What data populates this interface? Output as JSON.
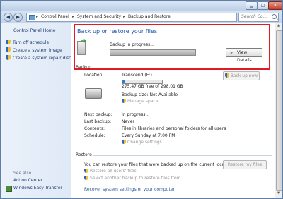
{
  "window": {
    "minimize_glyph": "▁",
    "maximize_glyph": "□",
    "close_glyph": "✕"
  },
  "nav": {
    "back_glyph": "◀",
    "forward_glyph": "▶",
    "breadcrumbs": [
      "Control Panel",
      "System and Security",
      "Backup and Restore"
    ],
    "separator": "▸",
    "refresh_glyph": "↻",
    "search_placeholder": "Search Co..."
  },
  "sidebar": {
    "home": "Control Panel Home",
    "links": [
      {
        "label": "Turn off schedule",
        "icon": "shield-icon"
      },
      {
        "label": "Create a system image",
        "icon": "shield-icon"
      },
      {
        "label": "Create a system repair disc",
        "icon": "shield-icon"
      }
    ],
    "see_also": "See also",
    "see_also_items": [
      "Action Center",
      "Windows Easy Transfer"
    ]
  },
  "main": {
    "title": "Back up or restore your files",
    "in_progress": {
      "status": "Backup in progress...",
      "progress_fraction": 0.0,
      "view_details": "View Details"
    },
    "backup_section": "Backup",
    "location_label": "Location:",
    "location_value": "Transcend (E:)",
    "drive_used_fraction": 0.08,
    "free_space": "275.47 GB free of 298.01 GB",
    "backup_size": "Backup size: Not Available",
    "manage_space": "Manage space",
    "back_up_now": "Back up now",
    "schedule_rows": [
      {
        "label": "Next backup:",
        "value": "In progress..."
      },
      {
        "label": "Last backup:",
        "value": "Never"
      },
      {
        "label": "Contents:",
        "value": "Files in libraries and personal folders for all users"
      },
      {
        "label": "Schedule:",
        "value": "Every Sunday at 7:00 PM"
      }
    ],
    "change_settings": "Change settings",
    "restore_section": "Restore",
    "restore_text": "You can restore your files that were backed up on the current location.",
    "restore_my_files": "Restore my files",
    "restore_all_users": "Restore all users' files",
    "select_another": "Select another backup to restore files from",
    "recover": "Recover system settings or your computer"
  },
  "colors": {
    "highlight_border": "#e01b24",
    "title_blue": "#1f56a5",
    "link_blue": "#2b5797"
  }
}
